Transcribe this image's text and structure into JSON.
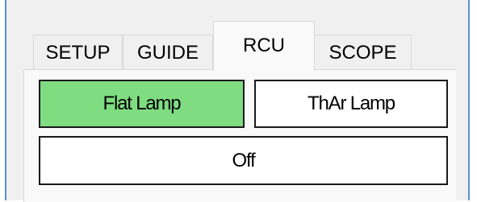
{
  "tabs": [
    {
      "label": "SETUP"
    },
    {
      "label": "GUIDE"
    },
    {
      "label": "RCU",
      "active": true
    },
    {
      "label": "SCOPE"
    }
  ],
  "rcu": {
    "flat_lamp_label": "Flat Lamp",
    "thar_lamp_label": "ThAr Lamp",
    "off_label": "Off",
    "active_color": "#7fdc81"
  }
}
